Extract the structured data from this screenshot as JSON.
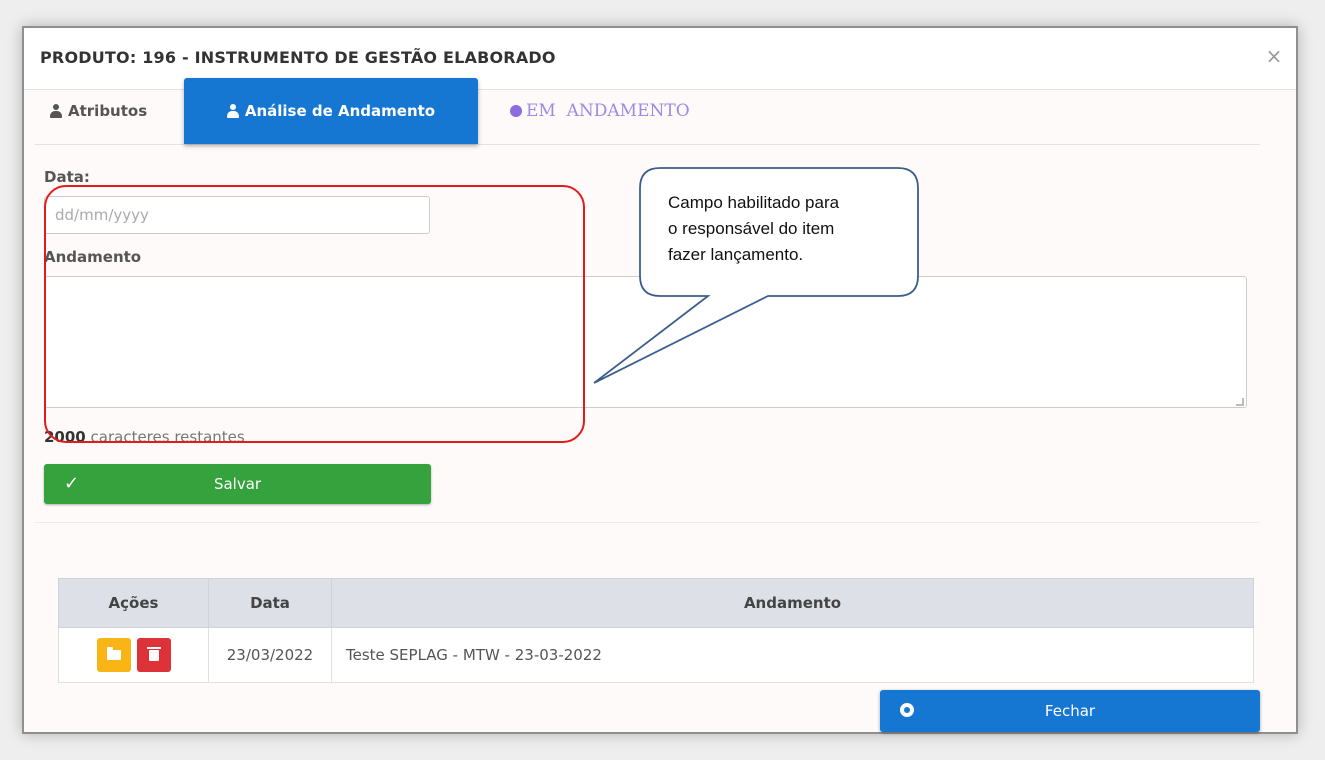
{
  "modal": {
    "title": "PRODUTO: 196 - INSTRUMENTO DE GESTÃO ELABORADO",
    "close_label": "×"
  },
  "tabs": [
    {
      "label": "Atributos",
      "icon": "user-icon"
    },
    {
      "label": "Análise de Andamento",
      "icon": "user-icon",
      "active": true
    },
    {
      "label": "EM  ANDAMENTO",
      "icon": "status-dot-icon"
    }
  ],
  "form": {
    "date_label": "Data:",
    "date_placeholder": "dd/mm/yyyy",
    "andamento_label": "Andamento",
    "counter_number": "2000",
    "counter_text": " caracteres restantes",
    "save_label": "Salvar"
  },
  "callout": {
    "lines": [
      "Campo habilitado para",
      "o responsável do item",
      "fazer lançamento."
    ]
  },
  "table": {
    "headers": [
      "Ações",
      "Data",
      "Andamento"
    ],
    "rows": [
      {
        "date": "23/03/2022",
        "andamento": "Teste SEPLAG - MTW - 23-03-2022"
      }
    ]
  },
  "footer": {
    "close_label": "Fechar"
  },
  "colors": {
    "primary": "#1677d2",
    "success": "#35a23d",
    "warning": "#f8b515",
    "danger": "#dd3237",
    "status": "#8c6ce0",
    "highlight": "#e21b1b",
    "callout_border": "#3a5f8a"
  }
}
